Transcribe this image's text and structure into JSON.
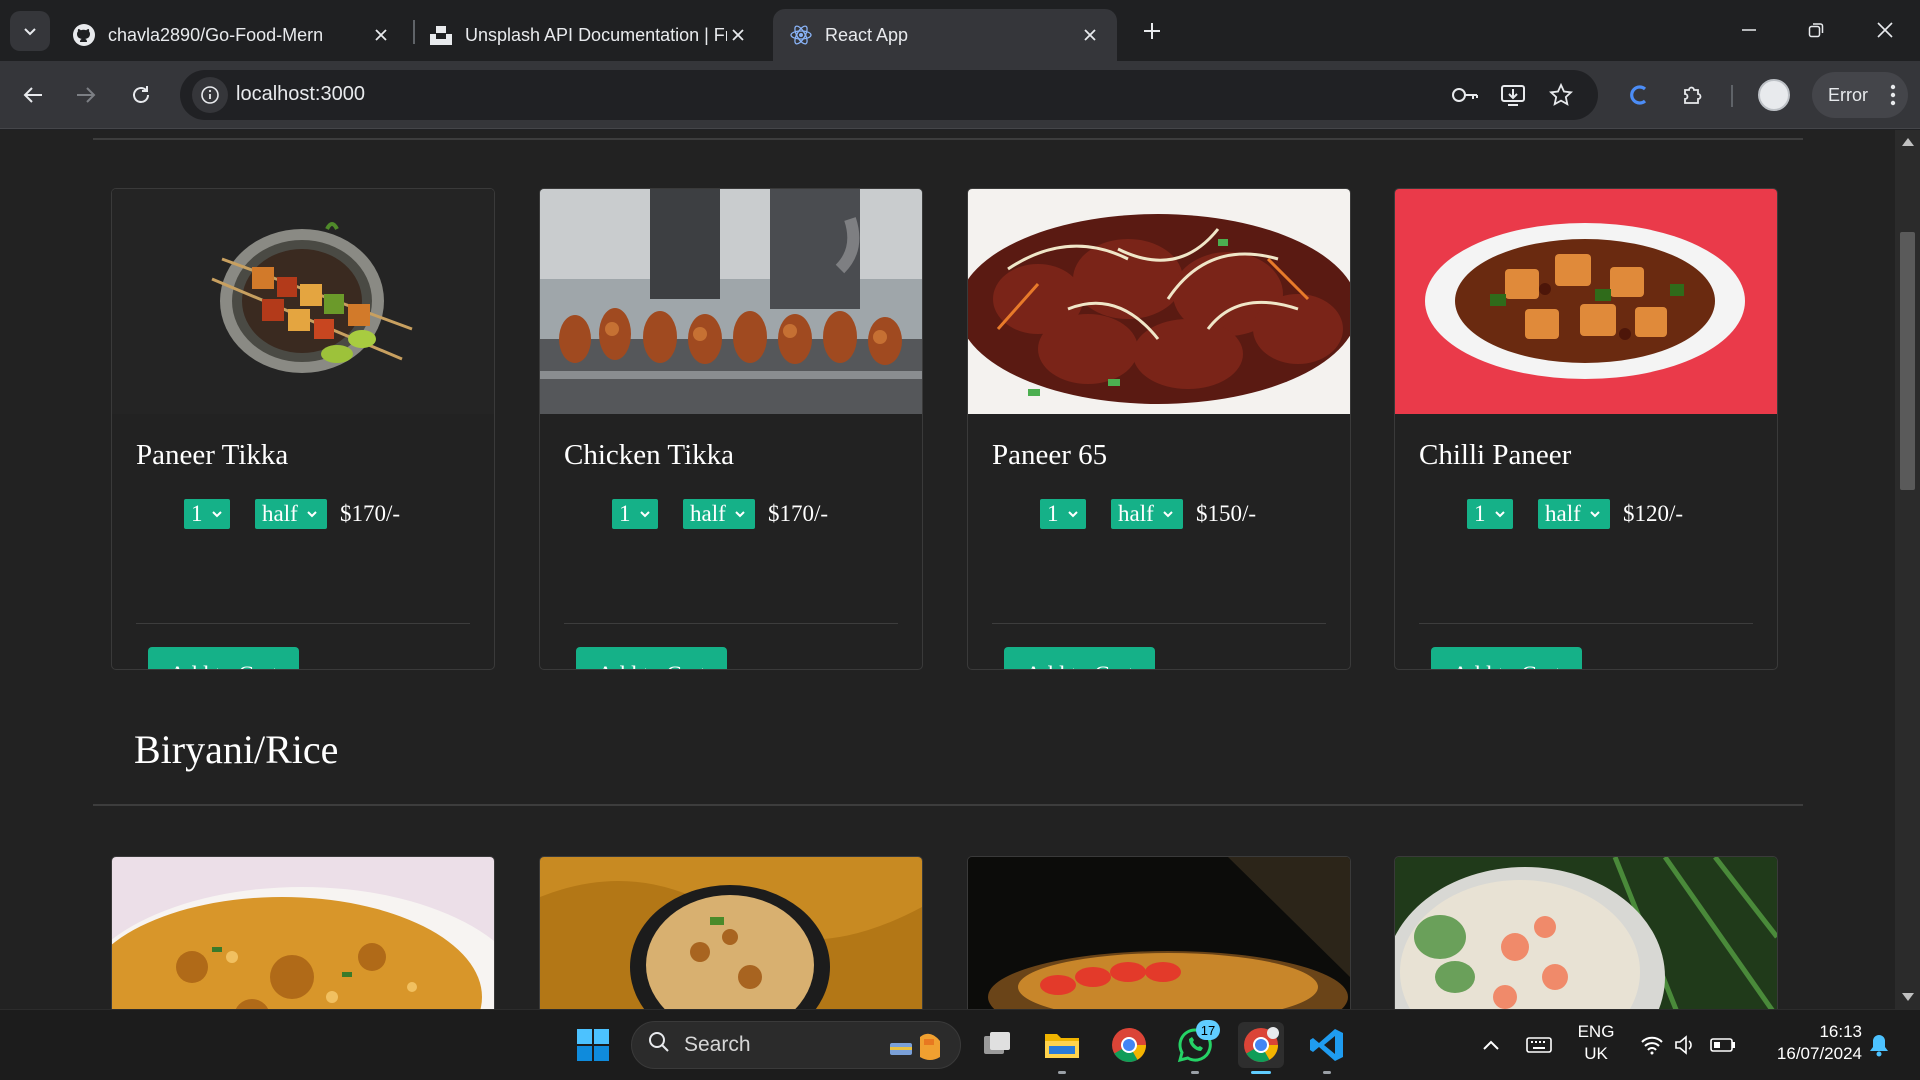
{
  "browser": {
    "tabs": [
      {
        "title": "chavla2890/Go-Food-Mern",
        "favicon": "github-icon",
        "active": false
      },
      {
        "title": "Unsplash API Documentation | Fr",
        "favicon": "unsplash-icon",
        "active": false
      },
      {
        "title": "React App",
        "favicon": "react-icon",
        "active": true
      }
    ],
    "url": "localhost:3000",
    "error_label": "Error"
  },
  "page": {
    "cards": [
      {
        "name": "Paneer Tikka",
        "qty": "1",
        "size": "half",
        "price": "$170/-",
        "button": "Add to Cart"
      },
      {
        "name": "Chicken Tikka",
        "qty": "1",
        "size": "half",
        "price": "$170/-",
        "button": "Add to Cart"
      },
      {
        "name": "Paneer 65",
        "qty": "1",
        "size": "half",
        "price": "$150/-",
        "button": "Add to Cart"
      },
      {
        "name": "Chilli Paneer",
        "qty": "1",
        "size": "half",
        "price": "$120/-",
        "button": "Add to Cart"
      }
    ],
    "section_title": "Biryani/Rice",
    "accent_color": "#15b188"
  },
  "taskbar": {
    "search_label": "Search",
    "whatsapp_badge": "17",
    "language": "ENG",
    "region": "UK",
    "time": "16:13",
    "date": "16/07/2024"
  }
}
